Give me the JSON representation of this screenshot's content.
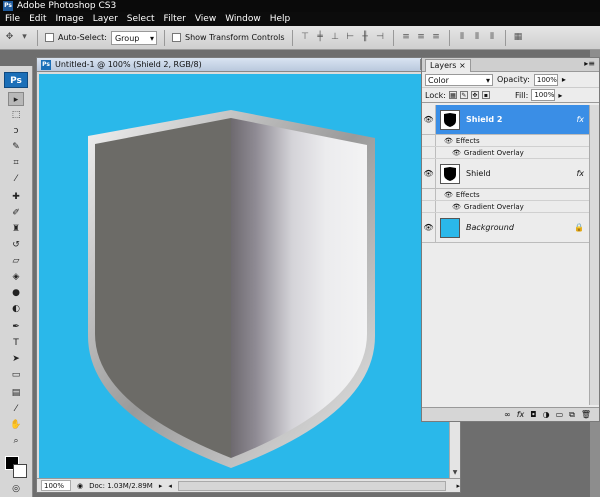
{
  "app": {
    "title": "Adobe Photoshop CS3",
    "logo": "Ps"
  },
  "menu": [
    "File",
    "Edit",
    "Image",
    "Layer",
    "Select",
    "Filter",
    "View",
    "Window",
    "Help"
  ],
  "options": {
    "auto_select_label": "Auto-Select:",
    "auto_select_value": "Group",
    "transform_label": "Show Transform Controls"
  },
  "document": {
    "title": "Untitled-1 @ 100% (Shield 2, RGB/8)",
    "zoom": "100%",
    "doc_info": "Doc: 1.03M/2.89M",
    "canvas_color": "#2ab8ea"
  },
  "layers_panel": {
    "tab": "Layers",
    "blend_mode": "Color",
    "opacity_label": "Opacity:",
    "opacity_value": "100%",
    "lock_label": "Lock:",
    "fill_label": "Fill:",
    "fill_value": "100%",
    "layers": [
      {
        "name": "Shield 2",
        "fx": "fx",
        "selected": true,
        "effects_label": "Effects",
        "effect": "Gradient Overlay"
      },
      {
        "name": "Shield",
        "fx": "fx",
        "selected": false,
        "effects_label": "Effects",
        "effect": "Gradient Overlay"
      },
      {
        "name": "Background",
        "selected": false,
        "lock": "lock-icon"
      }
    ]
  }
}
